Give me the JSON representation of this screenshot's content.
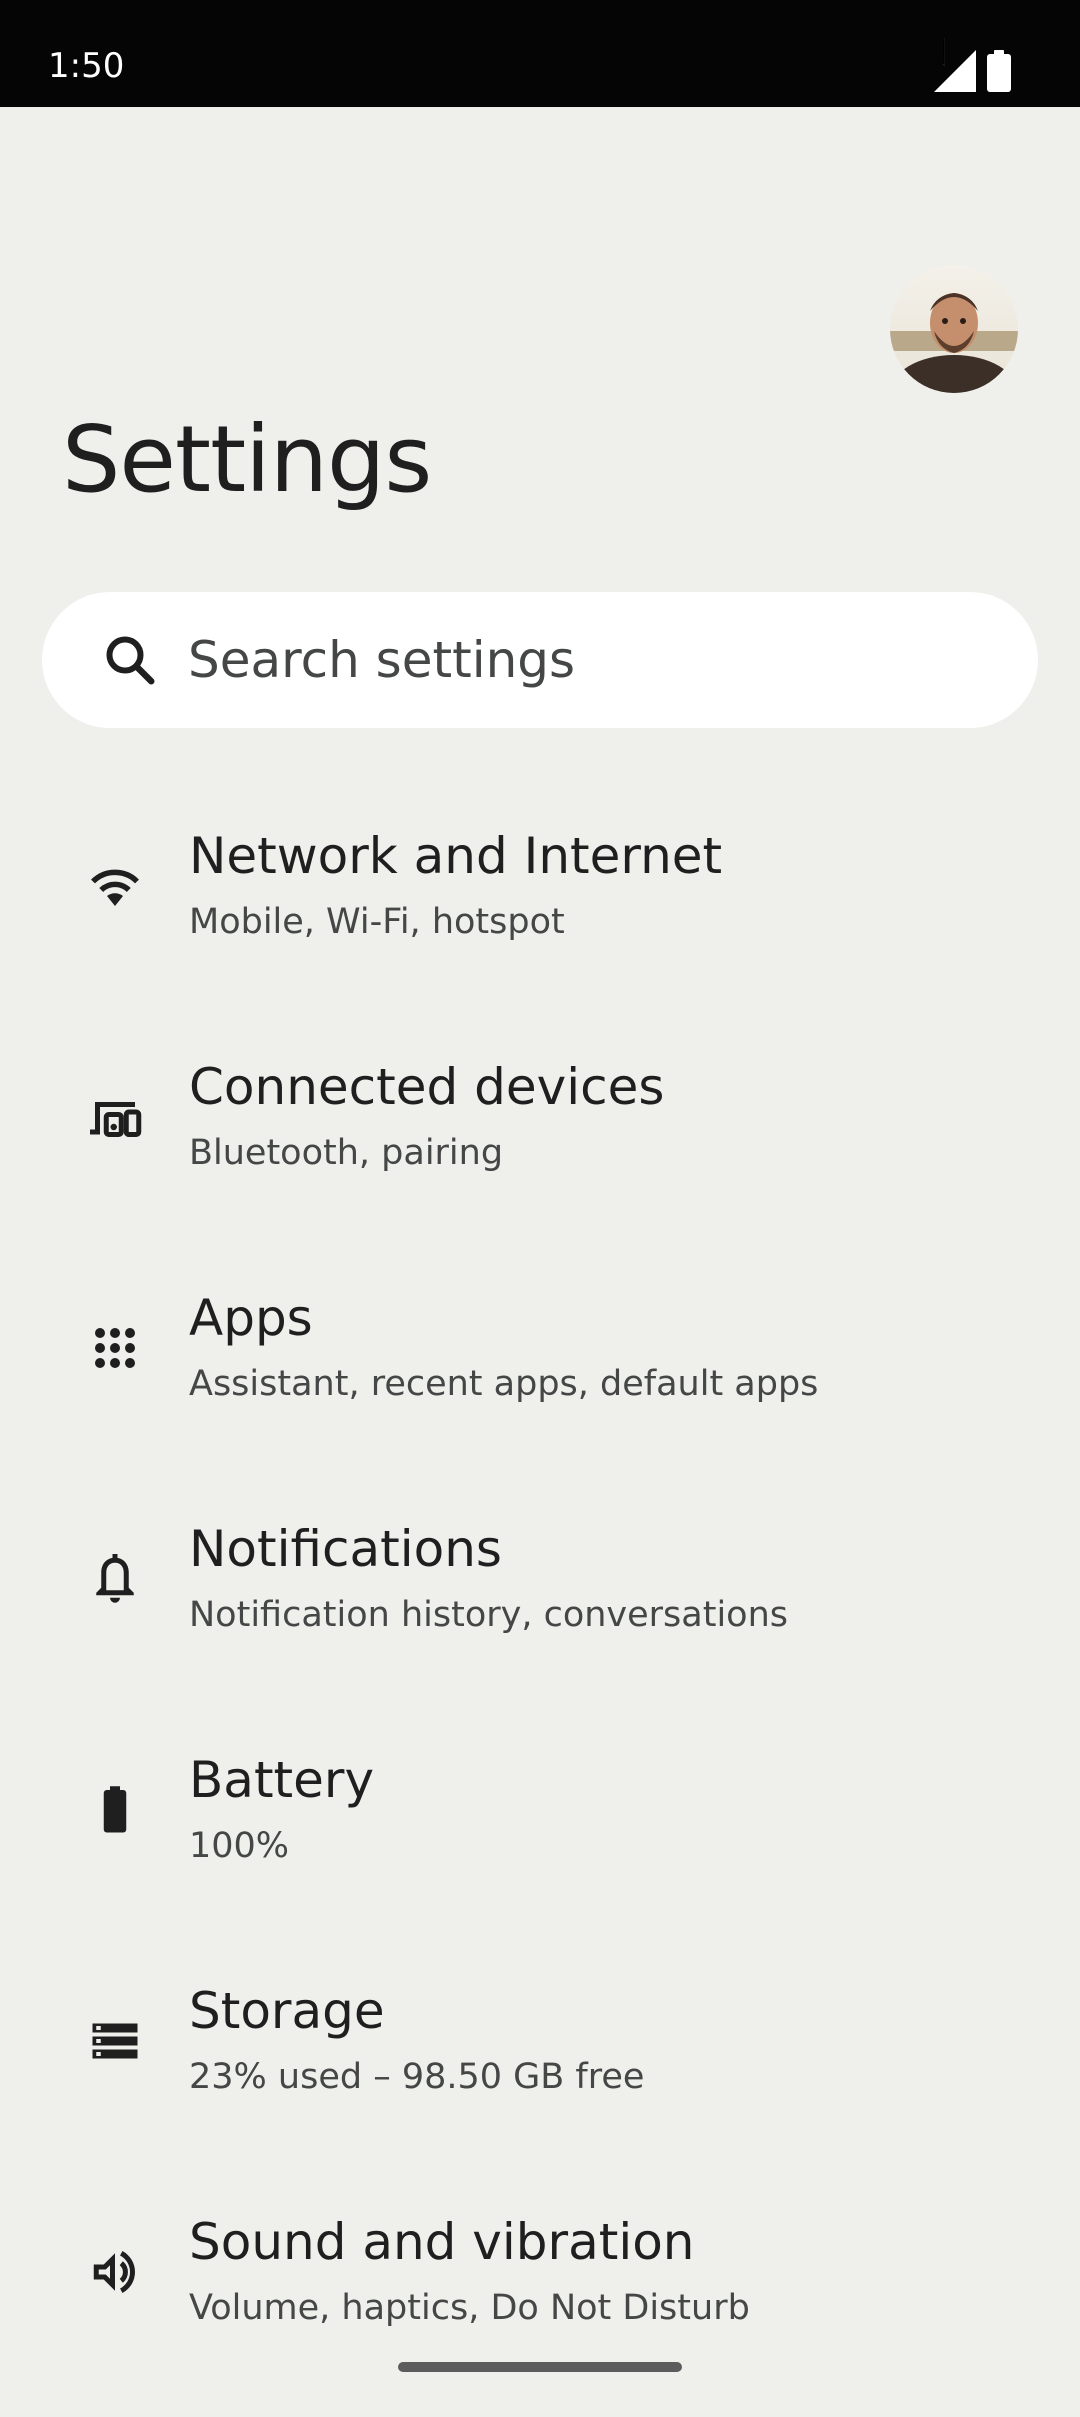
{
  "status_bar": {
    "time": "1:50"
  },
  "header": {
    "title": "Settings",
    "avatar_icon": "profile-photo"
  },
  "search": {
    "placeholder": "Search settings",
    "icon": "search-icon"
  },
  "items": [
    {
      "icon": "wifi-icon",
      "title": "Network and Internet",
      "subtitle": "Mobile, Wi-Fi, hotspot"
    },
    {
      "icon": "devices-icon",
      "title": "Connected devices",
      "subtitle": "Bluetooth, pairing"
    },
    {
      "icon": "apps-grid-icon",
      "title": "Apps",
      "subtitle": "Assistant, recent apps, default apps"
    },
    {
      "icon": "bell-icon",
      "title": "Notifications",
      "subtitle": "Notification history, conversations"
    },
    {
      "icon": "battery-icon",
      "title": "Battery",
      "subtitle": "100%"
    },
    {
      "icon": "storage-icon",
      "title": "Storage",
      "subtitle": "23% used – 98.50 GB free"
    },
    {
      "icon": "speaker-icon",
      "title": "Sound and vibration",
      "subtitle": "Volume, haptics, Do Not Disturb"
    }
  ],
  "colors": {
    "background": "#eff0ec",
    "status_bar": "#060506",
    "search_background": "#ffffff",
    "primary_text": "#1f1f1f",
    "secondary_text": "#444746"
  }
}
